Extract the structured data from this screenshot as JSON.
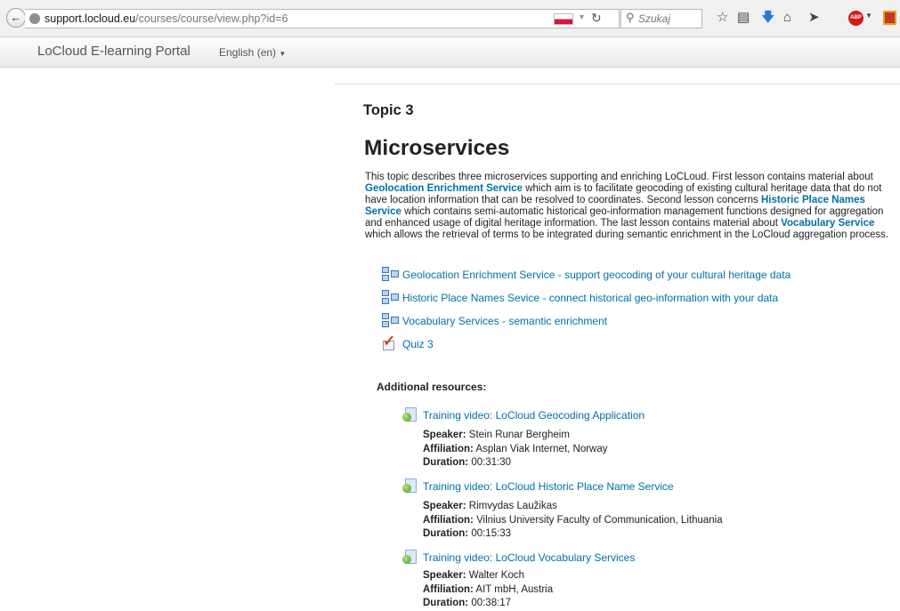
{
  "browser": {
    "url_host": "support.locloud.eu",
    "url_path": "/courses/course/view.php?id=6",
    "search_placeholder": "Szukaj",
    "abp_label": "ABP"
  },
  "site": {
    "brand": "LoCloud E-learning Portal",
    "language": "English (en)"
  },
  "section": {
    "heading": "Topic 3",
    "title": "Microservices",
    "summary": {
      "t1": "This topic describes three microservices supporting and enriching LoCLoud. First lesson contains material about ",
      "l1": "Geolocation Enrichment Service",
      "t2": " which aim is to facilitate geocoding of existing cultural heritage data that do not have location information that can be resolved to coordinates. Second lesson concerns ",
      "l2": "Historic Place Names Service",
      "t3": " which contains semi-automatic historical geo-information management functions designed for aggregation and enhanced usage of digital heritage information. The last lesson contains material about ",
      "l3": "Vocabulary Service",
      "t4": " which allows the retrieval of terms to be integrated during semantic enrichment in the LoCloud aggregation process."
    },
    "activities": [
      "Geolocation Enrichment Service - support geocoding of your cultural heritage data",
      "Historic Place Names Sevice - connect historical geo-information with your data",
      "Vocabulary Services - semantic enrichment",
      "Quiz 3"
    ],
    "additional_label": "Additional resources:",
    "labels": {
      "speaker": "Speaker:",
      "affiliation": "Affiliation:",
      "duration": "Duration:"
    },
    "resources": [
      {
        "title": "Training video: LoCloud Geocoding Application",
        "speaker": "Stein Runar Bergheim",
        "affiliation": "Asplan Viak Internet, Norway",
        "duration": "00:31:30"
      },
      {
        "title": "Training video: LoCloud Historic Place Name Service",
        "speaker": "Rimvydas Laužikas",
        "affiliation": "Vilnius University Faculty of Communication, Lithuania",
        "duration": "00:15:33"
      },
      {
        "title": "Training video: LoCloud Vocabulary Services",
        "speaker": "Walter Koch",
        "affiliation": "AIT mbH, Austria",
        "duration": "00:38:17"
      }
    ]
  }
}
